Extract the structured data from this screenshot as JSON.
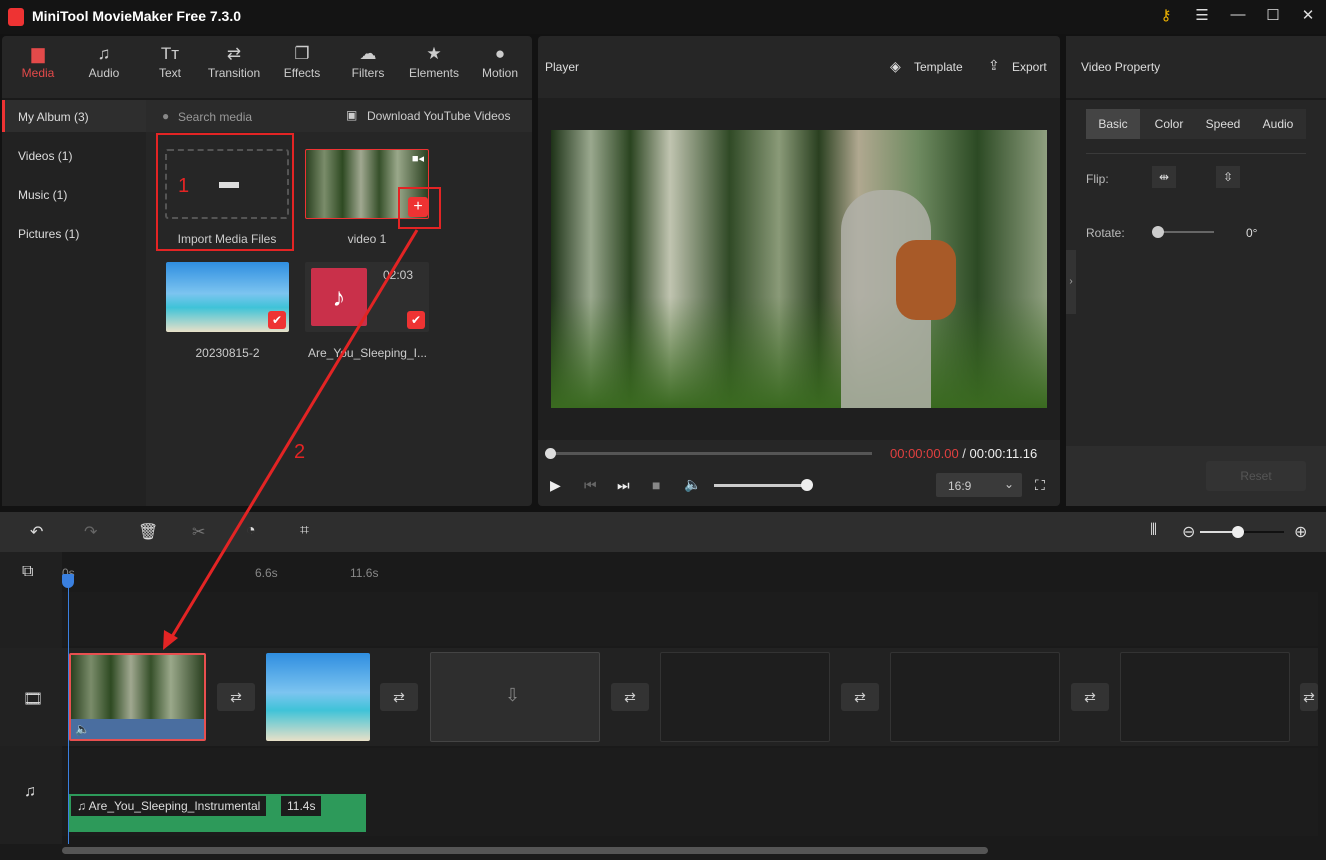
{
  "app": {
    "title": "MiniTool MovieMaker Free 7.3.0",
    "icons": [
      "key-icon",
      "menu-icon",
      "minimize-icon",
      "maximize-icon",
      "close-icon"
    ]
  },
  "tabs": [
    {
      "label": "Media",
      "icon": "▆"
    },
    {
      "label": "Audio",
      "icon": "♫"
    },
    {
      "label": "Text",
      "icon": "Tт"
    },
    {
      "label": "Transition",
      "icon": "⇄"
    },
    {
      "label": "Effects",
      "icon": "❐"
    },
    {
      "label": "Filters",
      "icon": "☁"
    },
    {
      "label": "Elements",
      "icon": "★"
    },
    {
      "label": "Motion",
      "icon": "●"
    }
  ],
  "sidebar": [
    {
      "label": "My Album (3)"
    },
    {
      "label": "Videos (1)"
    },
    {
      "label": "Music (1)"
    },
    {
      "label": "Pictures (1)"
    }
  ],
  "media": {
    "search_placeholder": "Search media",
    "download": "Download YouTube Videos",
    "import": "Import Media Files",
    "items": [
      {
        "name": "video 1"
      },
      {
        "name": "20230815-2"
      },
      {
        "name": "Are_You_Sleeping_I...",
        "duration": "02:03"
      }
    ]
  },
  "annotations": {
    "step1": "1",
    "step2": "2",
    "color": "#e32424"
  },
  "player": {
    "title": "Player",
    "template": "Template",
    "export": "Export",
    "current_time": "00:00:00.00",
    "separator": " / ",
    "total_time": "00:00:11.16",
    "aspect": "16:9",
    "progress": 0,
    "volume": 1
  },
  "property": {
    "title": "Video Property",
    "tabs": [
      "Basic",
      "Color",
      "Speed",
      "Audio"
    ],
    "flip": "Flip:",
    "rotate": "Rotate:",
    "rotate_value": "0°",
    "reset": "Reset"
  },
  "timeline": {
    "ruler": [
      "0s",
      "6.6s",
      "11.6s"
    ],
    "audio_clip": "Are_You_Sleeping_Instrumental",
    "audio_duration": "11.4s",
    "zoom_level": 0.6
  }
}
